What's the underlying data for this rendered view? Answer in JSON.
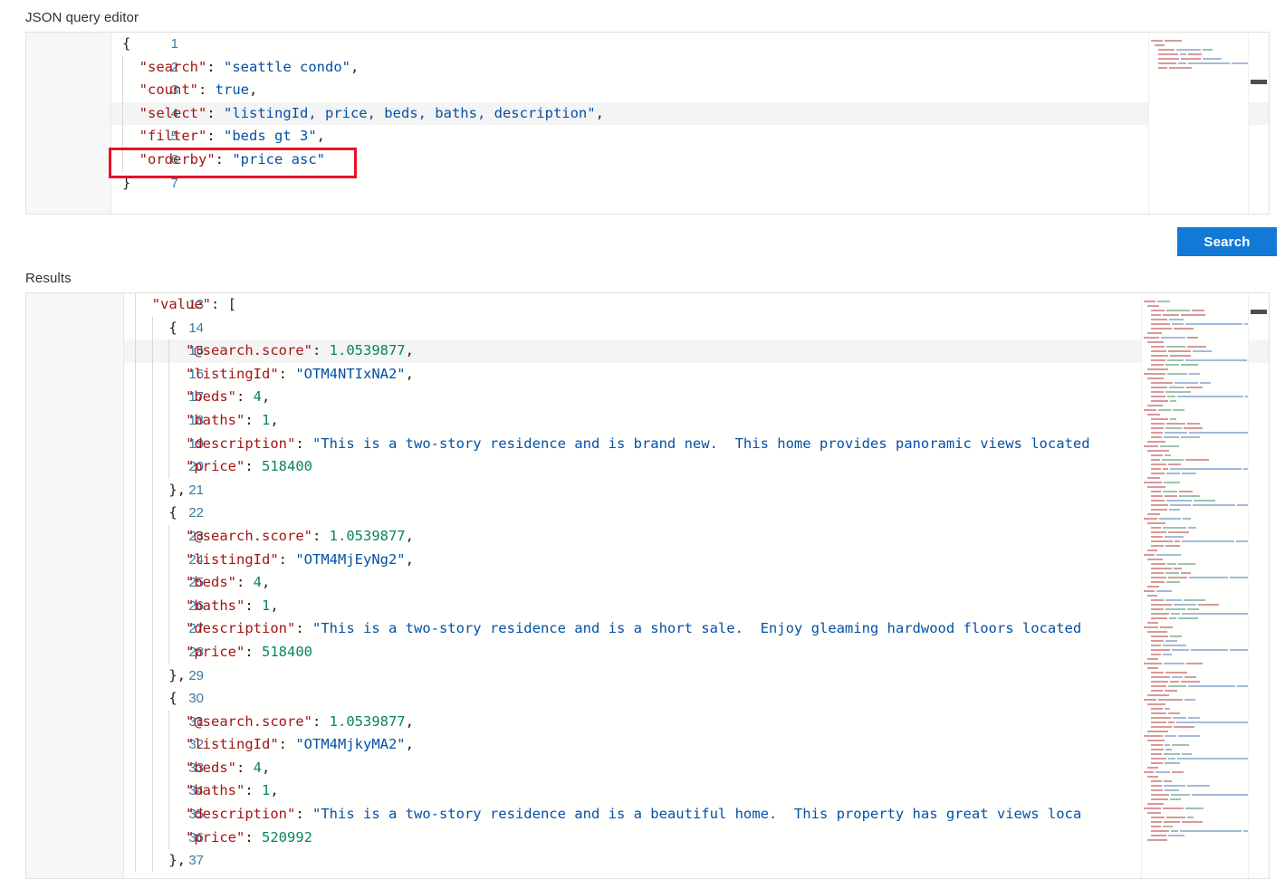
{
  "labels": {
    "editor": "JSON query editor",
    "results": "Results"
  },
  "toolbar": {
    "search_label": "Search",
    "accent_color": "#1379d6"
  },
  "annotation": {
    "highlight_color": "#e81123",
    "target_line": 6,
    "target_text": "\"orderby\": \"price asc\""
  },
  "query_editor": {
    "first_line": 1,
    "active_line": 4,
    "lines": [
      {
        "n": 1,
        "indent": 0,
        "tokens": [
          {
            "t": "{",
            "c": "p"
          }
        ]
      },
      {
        "n": 2,
        "indent": 1,
        "tokens": [
          {
            "t": "\"search\"",
            "c": "k"
          },
          {
            "t": ": ",
            "c": "p"
          },
          {
            "t": "\"seattle condo\"",
            "c": "s"
          },
          {
            "t": ",",
            "c": "p"
          }
        ]
      },
      {
        "n": 3,
        "indent": 1,
        "tokens": [
          {
            "t": "\"count\"",
            "c": "k"
          },
          {
            "t": ": ",
            "c": "p"
          },
          {
            "t": "true",
            "c": "s"
          },
          {
            "t": ",",
            "c": "p"
          }
        ]
      },
      {
        "n": 4,
        "indent": 1,
        "tokens": [
          {
            "t": "\"select\"",
            "c": "k"
          },
          {
            "t": ": ",
            "c": "p"
          },
          {
            "t": "\"listingId, price, beds, baths, description\"",
            "c": "s"
          },
          {
            "t": ",",
            "c": "p"
          }
        ]
      },
      {
        "n": 5,
        "indent": 1,
        "tokens": [
          {
            "t": "\"filter\"",
            "c": "k"
          },
          {
            "t": ": ",
            "c": "p"
          },
          {
            "t": "\"beds gt 3\"",
            "c": "s"
          },
          {
            "t": ",",
            "c": "p"
          }
        ]
      },
      {
        "n": 6,
        "indent": 1,
        "tokens": [
          {
            "t": "\"orderby\"",
            "c": "k"
          },
          {
            "t": ": ",
            "c": "p"
          },
          {
            "t": "\"price asc\"",
            "c": "s"
          }
        ]
      },
      {
        "n": 7,
        "indent": 0,
        "tokens": [
          {
            "t": "}",
            "c": "p"
          }
        ]
      }
    ]
  },
  "results_editor": {
    "first_line": 13,
    "active_line": 15,
    "lines": [
      {
        "n": 13,
        "indent": 1,
        "tokens": [
          {
            "t": "\"value\"",
            "c": "k"
          },
          {
            "t": ": [",
            "c": "p"
          }
        ]
      },
      {
        "n": 14,
        "indent": 2,
        "tokens": [
          {
            "t": "{",
            "c": "p"
          }
        ]
      },
      {
        "n": 15,
        "indent": 3,
        "tokens": [
          {
            "t": "\"@search.score\"",
            "c": "k"
          },
          {
            "t": ": ",
            "c": "p"
          },
          {
            "t": "1.0539877",
            "c": "n"
          },
          {
            "t": ",",
            "c": "p"
          }
        ]
      },
      {
        "n": 16,
        "indent": 3,
        "tokens": [
          {
            "t": "\"listingId\"",
            "c": "k"
          },
          {
            "t": ": ",
            "c": "p"
          },
          {
            "t": "\"OTM4NTIxNA2\"",
            "c": "s"
          },
          {
            "t": ",",
            "c": "p"
          }
        ]
      },
      {
        "n": 17,
        "indent": 3,
        "tokens": [
          {
            "t": "\"beds\"",
            "c": "k"
          },
          {
            "t": ": ",
            "c": "p"
          },
          {
            "t": "4",
            "c": "n"
          },
          {
            "t": ",",
            "c": "p"
          }
        ]
      },
      {
        "n": 18,
        "indent": 3,
        "tokens": [
          {
            "t": "\"baths\"",
            "c": "k"
          },
          {
            "t": ": ",
            "c": "p"
          },
          {
            "t": "1",
            "c": "n"
          },
          {
            "t": ",",
            "c": "p"
          }
        ]
      },
      {
        "n": 19,
        "indent": 3,
        "tokens": [
          {
            "t": "\"description\"",
            "c": "k"
          },
          {
            "t": ": ",
            "c": "p"
          },
          {
            "t": "\"This is a two-story residence and is brand new.  This home provides panoramic views located",
            "c": "s"
          }
        ]
      },
      {
        "n": 20,
        "indent": 3,
        "tokens": [
          {
            "t": "\"price\"",
            "c": "k"
          },
          {
            "t": ": ",
            "c": "p"
          },
          {
            "t": "518400",
            "c": "n"
          }
        ]
      },
      {
        "n": 21,
        "indent": 2,
        "tokens": [
          {
            "t": "},",
            "c": "p"
          }
        ]
      },
      {
        "n": 22,
        "indent": 2,
        "tokens": [
          {
            "t": "{",
            "c": "p"
          }
        ]
      },
      {
        "n": 23,
        "indent": 3,
        "tokens": [
          {
            "t": "\"@search.score\"",
            "c": "k"
          },
          {
            "t": ": ",
            "c": "p"
          },
          {
            "t": "1.0539877",
            "c": "n"
          },
          {
            "t": ",",
            "c": "p"
          }
        ]
      },
      {
        "n": 24,
        "indent": 3,
        "tokens": [
          {
            "t": "\"listingId\"",
            "c": "k"
          },
          {
            "t": ": ",
            "c": "p"
          },
          {
            "t": "\"OTM4MjEyNg2\"",
            "c": "s"
          },
          {
            "t": ",",
            "c": "p"
          }
        ]
      },
      {
        "n": 25,
        "indent": 3,
        "tokens": [
          {
            "t": "\"beds\"",
            "c": "k"
          },
          {
            "t": ": ",
            "c": "p"
          },
          {
            "t": "4",
            "c": "n"
          },
          {
            "t": ",",
            "c": "p"
          }
        ]
      },
      {
        "n": 26,
        "indent": 3,
        "tokens": [
          {
            "t": "\"baths\"",
            "c": "k"
          },
          {
            "t": ": ",
            "c": "p"
          },
          {
            "t": "1",
            "c": "n"
          },
          {
            "t": ",",
            "c": "p"
          }
        ]
      },
      {
        "n": 27,
        "indent": 3,
        "tokens": [
          {
            "t": "\"description\"",
            "c": "k"
          },
          {
            "t": ": ",
            "c": "p"
          },
          {
            "t": "\"This is a two-story residence and is a short sale.  Enjoy gleaming hardwood floors located",
            "c": "s"
          }
        ]
      },
      {
        "n": 28,
        "indent": 3,
        "tokens": [
          {
            "t": "\"price\"",
            "c": "k"
          },
          {
            "t": ": ",
            "c": "p"
          },
          {
            "t": "518400",
            "c": "n"
          }
        ]
      },
      {
        "n": 29,
        "indent": 2,
        "tokens": [
          {
            "t": "},",
            "c": "p"
          }
        ]
      },
      {
        "n": 30,
        "indent": 2,
        "tokens": [
          {
            "t": "{",
            "c": "p"
          }
        ]
      },
      {
        "n": 31,
        "indent": 3,
        "tokens": [
          {
            "t": "\"@search.score\"",
            "c": "k"
          },
          {
            "t": ": ",
            "c": "p"
          },
          {
            "t": "1.0539877",
            "c": "n"
          },
          {
            "t": ",",
            "c": "p"
          }
        ]
      },
      {
        "n": 32,
        "indent": 3,
        "tokens": [
          {
            "t": "\"listingId\"",
            "c": "k"
          },
          {
            "t": ": ",
            "c": "p"
          },
          {
            "t": "\"OTM4MjkyMA2\"",
            "c": "s"
          },
          {
            "t": ",",
            "c": "p"
          }
        ]
      },
      {
        "n": 33,
        "indent": 3,
        "tokens": [
          {
            "t": "\"beds\"",
            "c": "k"
          },
          {
            "t": ": ",
            "c": "p"
          },
          {
            "t": "4",
            "c": "n"
          },
          {
            "t": ",",
            "c": "p"
          }
        ]
      },
      {
        "n": 34,
        "indent": 3,
        "tokens": [
          {
            "t": "\"baths\"",
            "c": "k"
          },
          {
            "t": ": ",
            "c": "p"
          },
          {
            "t": "1",
            "c": "n"
          },
          {
            "t": ",",
            "c": "p"
          }
        ]
      },
      {
        "n": 35,
        "indent": 3,
        "tokens": [
          {
            "t": "\"description\"",
            "c": "k"
          },
          {
            "t": ": ",
            "c": "p"
          },
          {
            "t": "\"This is a two-story residence and is a beautiful home.  This property has great views loca",
            "c": "s"
          }
        ]
      },
      {
        "n": 36,
        "indent": 3,
        "tokens": [
          {
            "t": "\"price\"",
            "c": "k"
          },
          {
            "t": ": ",
            "c": "p"
          },
          {
            "t": "520992",
            "c": "n"
          }
        ]
      },
      {
        "n": 37,
        "indent": 2,
        "tokens": [
          {
            "t": "},",
            "c": "p"
          }
        ]
      }
    ]
  },
  "minimap": {
    "query_rows": 7,
    "results_rows": 120
  }
}
